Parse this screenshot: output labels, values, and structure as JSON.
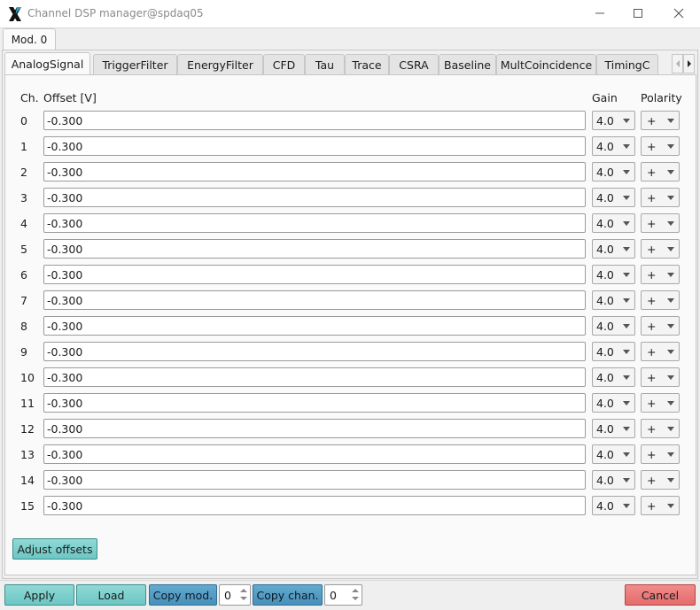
{
  "window": {
    "title": "Channel DSP manager@spdaq05"
  },
  "module_tab": "Mod. 0",
  "tabs": [
    "AnalogSignal",
    "TriggerFilter",
    "EnergyFilter",
    "CFD",
    "Tau",
    "Trace",
    "CSRA",
    "Baseline",
    "MultCoincidence",
    "TimingC"
  ],
  "active_tab": "AnalogSignal",
  "headers": {
    "channel": "Ch.",
    "offset": "Offset [V]",
    "gain": "Gain",
    "polarity": "Polarity"
  },
  "channels": [
    {
      "ch": "0",
      "offset": "-0.300",
      "gain": "4.0",
      "polarity": "+"
    },
    {
      "ch": "1",
      "offset": "-0.300",
      "gain": "4.0",
      "polarity": "+"
    },
    {
      "ch": "2",
      "offset": "-0.300",
      "gain": "4.0",
      "polarity": "+"
    },
    {
      "ch": "3",
      "offset": "-0.300",
      "gain": "4.0",
      "polarity": "+"
    },
    {
      "ch": "4",
      "offset": "-0.300",
      "gain": "4.0",
      "polarity": "+"
    },
    {
      "ch": "5",
      "offset": "-0.300",
      "gain": "4.0",
      "polarity": "+"
    },
    {
      "ch": "6",
      "offset": "-0.300",
      "gain": "4.0",
      "polarity": "+"
    },
    {
      "ch": "7",
      "offset": "-0.300",
      "gain": "4.0",
      "polarity": "+"
    },
    {
      "ch": "8",
      "offset": "-0.300",
      "gain": "4.0",
      "polarity": "+"
    },
    {
      "ch": "9",
      "offset": "-0.300",
      "gain": "4.0",
      "polarity": "+"
    },
    {
      "ch": "10",
      "offset": "-0.300",
      "gain": "4.0",
      "polarity": "+"
    },
    {
      "ch": "11",
      "offset": "-0.300",
      "gain": "4.0",
      "polarity": "+"
    },
    {
      "ch": "12",
      "offset": "-0.300",
      "gain": "4.0",
      "polarity": "+"
    },
    {
      "ch": "13",
      "offset": "-0.300",
      "gain": "4.0",
      "polarity": "+"
    },
    {
      "ch": "14",
      "offset": "-0.300",
      "gain": "4.0",
      "polarity": "+"
    },
    {
      "ch": "15",
      "offset": "-0.300",
      "gain": "4.0",
      "polarity": "+"
    }
  ],
  "buttons": {
    "adjust_offsets": "Adjust offsets",
    "apply": "Apply",
    "load": "Load",
    "copy_mod": "Copy mod.",
    "copy_chan": "Copy chan.",
    "cancel": "Cancel"
  },
  "spinboxes": {
    "copy_mod_value": "0",
    "copy_chan_value": "0"
  },
  "colors": {
    "teal_button": "#7ccfcc",
    "blue_button": "#559dc5",
    "red_button": "#eb7a7a"
  }
}
